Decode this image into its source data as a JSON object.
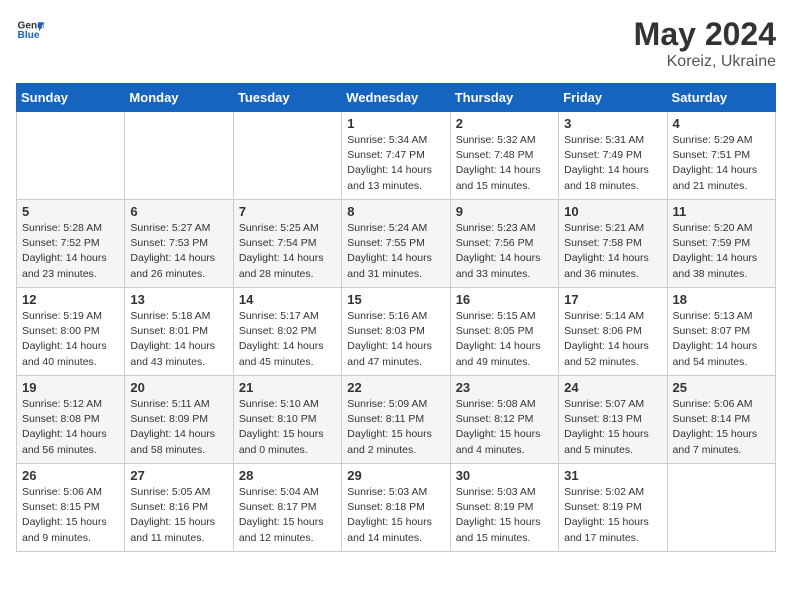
{
  "header": {
    "logo_general": "General",
    "logo_blue": "Blue",
    "title": "May 2024",
    "location": "Koreiz, Ukraine"
  },
  "weekdays": [
    "Sunday",
    "Monday",
    "Tuesday",
    "Wednesday",
    "Thursday",
    "Friday",
    "Saturday"
  ],
  "weeks": [
    [
      {
        "day": "",
        "info": ""
      },
      {
        "day": "",
        "info": ""
      },
      {
        "day": "",
        "info": ""
      },
      {
        "day": "1",
        "info": "Sunrise: 5:34 AM\nSunset: 7:47 PM\nDaylight: 14 hours\nand 13 minutes."
      },
      {
        "day": "2",
        "info": "Sunrise: 5:32 AM\nSunset: 7:48 PM\nDaylight: 14 hours\nand 15 minutes."
      },
      {
        "day": "3",
        "info": "Sunrise: 5:31 AM\nSunset: 7:49 PM\nDaylight: 14 hours\nand 18 minutes."
      },
      {
        "day": "4",
        "info": "Sunrise: 5:29 AM\nSunset: 7:51 PM\nDaylight: 14 hours\nand 21 minutes."
      }
    ],
    [
      {
        "day": "5",
        "info": "Sunrise: 5:28 AM\nSunset: 7:52 PM\nDaylight: 14 hours\nand 23 minutes."
      },
      {
        "day": "6",
        "info": "Sunrise: 5:27 AM\nSunset: 7:53 PM\nDaylight: 14 hours\nand 26 minutes."
      },
      {
        "day": "7",
        "info": "Sunrise: 5:25 AM\nSunset: 7:54 PM\nDaylight: 14 hours\nand 28 minutes."
      },
      {
        "day": "8",
        "info": "Sunrise: 5:24 AM\nSunset: 7:55 PM\nDaylight: 14 hours\nand 31 minutes."
      },
      {
        "day": "9",
        "info": "Sunrise: 5:23 AM\nSunset: 7:56 PM\nDaylight: 14 hours\nand 33 minutes."
      },
      {
        "day": "10",
        "info": "Sunrise: 5:21 AM\nSunset: 7:58 PM\nDaylight: 14 hours\nand 36 minutes."
      },
      {
        "day": "11",
        "info": "Sunrise: 5:20 AM\nSunset: 7:59 PM\nDaylight: 14 hours\nand 38 minutes."
      }
    ],
    [
      {
        "day": "12",
        "info": "Sunrise: 5:19 AM\nSunset: 8:00 PM\nDaylight: 14 hours\nand 40 minutes."
      },
      {
        "day": "13",
        "info": "Sunrise: 5:18 AM\nSunset: 8:01 PM\nDaylight: 14 hours\nand 43 minutes."
      },
      {
        "day": "14",
        "info": "Sunrise: 5:17 AM\nSunset: 8:02 PM\nDaylight: 14 hours\nand 45 minutes."
      },
      {
        "day": "15",
        "info": "Sunrise: 5:16 AM\nSunset: 8:03 PM\nDaylight: 14 hours\nand 47 minutes."
      },
      {
        "day": "16",
        "info": "Sunrise: 5:15 AM\nSunset: 8:05 PM\nDaylight: 14 hours\nand 49 minutes."
      },
      {
        "day": "17",
        "info": "Sunrise: 5:14 AM\nSunset: 8:06 PM\nDaylight: 14 hours\nand 52 minutes."
      },
      {
        "day": "18",
        "info": "Sunrise: 5:13 AM\nSunset: 8:07 PM\nDaylight: 14 hours\nand 54 minutes."
      }
    ],
    [
      {
        "day": "19",
        "info": "Sunrise: 5:12 AM\nSunset: 8:08 PM\nDaylight: 14 hours\nand 56 minutes."
      },
      {
        "day": "20",
        "info": "Sunrise: 5:11 AM\nSunset: 8:09 PM\nDaylight: 14 hours\nand 58 minutes."
      },
      {
        "day": "21",
        "info": "Sunrise: 5:10 AM\nSunset: 8:10 PM\nDaylight: 15 hours\nand 0 minutes."
      },
      {
        "day": "22",
        "info": "Sunrise: 5:09 AM\nSunset: 8:11 PM\nDaylight: 15 hours\nand 2 minutes."
      },
      {
        "day": "23",
        "info": "Sunrise: 5:08 AM\nSunset: 8:12 PM\nDaylight: 15 hours\nand 4 minutes."
      },
      {
        "day": "24",
        "info": "Sunrise: 5:07 AM\nSunset: 8:13 PM\nDaylight: 15 hours\nand 5 minutes."
      },
      {
        "day": "25",
        "info": "Sunrise: 5:06 AM\nSunset: 8:14 PM\nDaylight: 15 hours\nand 7 minutes."
      }
    ],
    [
      {
        "day": "26",
        "info": "Sunrise: 5:06 AM\nSunset: 8:15 PM\nDaylight: 15 hours\nand 9 minutes."
      },
      {
        "day": "27",
        "info": "Sunrise: 5:05 AM\nSunset: 8:16 PM\nDaylight: 15 hours\nand 11 minutes."
      },
      {
        "day": "28",
        "info": "Sunrise: 5:04 AM\nSunset: 8:17 PM\nDaylight: 15 hours\nand 12 minutes."
      },
      {
        "day": "29",
        "info": "Sunrise: 5:03 AM\nSunset: 8:18 PM\nDaylight: 15 hours\nand 14 minutes."
      },
      {
        "day": "30",
        "info": "Sunrise: 5:03 AM\nSunset: 8:19 PM\nDaylight: 15 hours\nand 15 minutes."
      },
      {
        "day": "31",
        "info": "Sunrise: 5:02 AM\nSunset: 8:19 PM\nDaylight: 15 hours\nand 17 minutes."
      },
      {
        "day": "",
        "info": ""
      }
    ]
  ]
}
